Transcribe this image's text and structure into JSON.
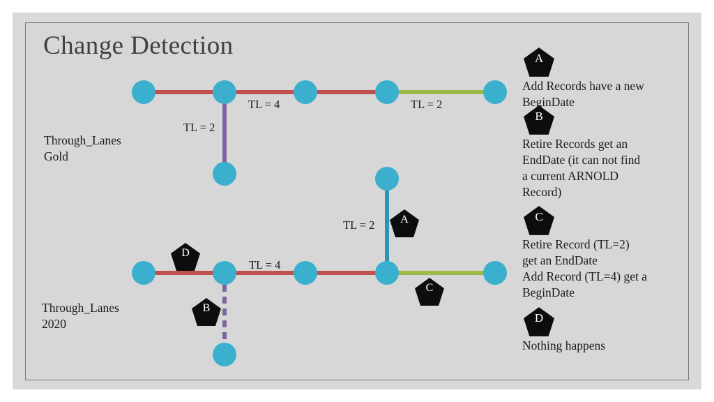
{
  "slide": {
    "title": "Change Detection",
    "background_color": "#d7d7d7",
    "frame_color": "#7a7a7a"
  },
  "palette": {
    "node": "#3bafce",
    "red": "#c0504d",
    "green": "#9bbb46",
    "purple": "#8064a2",
    "teal": "#2e93b4",
    "badge": "#0d0d0d"
  },
  "diagrams": [
    {
      "name": "through-lanes-gold",
      "row_label_line1": "Through_Lanes",
      "row_label_line2": "Gold",
      "edge_labels": {
        "main_left": "TL = 4",
        "main_right": "TL = 2",
        "branch": "TL = 2"
      }
    },
    {
      "name": "through-lanes-2020",
      "row_label_line1": "Through_Lanes",
      "row_label_line2": "2020",
      "edge_labels": {
        "main_left": "TL = 4",
        "branch_up": "TL = 2"
      }
    }
  ],
  "badges": {
    "top_a": "A",
    "bottom_a": "A",
    "bottom_b": "B",
    "bottom_c": "C",
    "bottom_d": "D"
  },
  "legend": [
    {
      "key": "A",
      "text": "Add Records have a new\nBeginDate"
    },
    {
      "key": "B",
      "text": "Retire Records get an\nEndDate (it can not find\na current ARNOLD\nRecord)"
    },
    {
      "key": "C",
      "text": "Retire Record (TL=2)\nget an EndDate\nAdd Record (TL=4) get a\nBeginDate"
    },
    {
      "key": "D",
      "text": "Nothing happens"
    }
  ]
}
